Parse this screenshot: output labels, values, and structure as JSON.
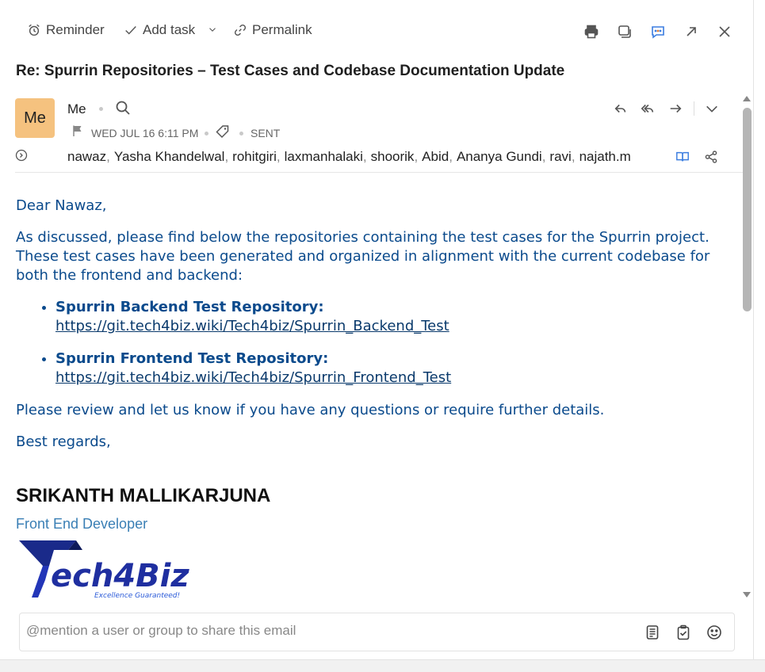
{
  "toolbar": {
    "reminder": "Reminder",
    "add_task": "Add task",
    "permalink": "Permalink"
  },
  "subject": "Re: Spurrin Repositories – Test Cases and Codebase Documentation Update",
  "header": {
    "avatar_initials": "Me",
    "sender": "Me",
    "date": "WED JUL 16 6:11 PM",
    "status": "SENT",
    "recipients": [
      "nawaz",
      "Yasha Khandelwal",
      "rohitgiri",
      "laxmanhalaki",
      "shoorik",
      "Abid",
      "Ananya Gundi",
      "ravi",
      "najath.m"
    ],
    "avatar_color": "#f5c27f"
  },
  "body": {
    "greeting": "Dear Nawaz,",
    "intro": "As discussed, please find below the repositories containing the test cases for the Spurrin project. These test cases have been generated and organized in alignment with the current codebase for both the frontend and backend:",
    "repos": [
      {
        "label": "Spurrin Backend Test Repository:",
        "url": "https://git.tech4biz.wiki/Tech4biz/Spurrin_Backend_Test"
      },
      {
        "label": "Spurrin Frontend Test Repository:",
        "url": "https://git.tech4biz.wiki/Tech4biz/Spurrin_Frontend_Test"
      }
    ],
    "closing": "Please review and let us know if you have any questions or require further details.",
    "regards": "Best regards,",
    "text_color": "#0a4a8c"
  },
  "signature": {
    "name": "SRIKANTH MALLIKARJUNA",
    "role": "Front End Developer",
    "logo_text": "Tech4Biz",
    "logo_tagline": "Excellence Guaranteed!"
  },
  "comment": {
    "placeholder": "@mention a user or group to share this email"
  }
}
